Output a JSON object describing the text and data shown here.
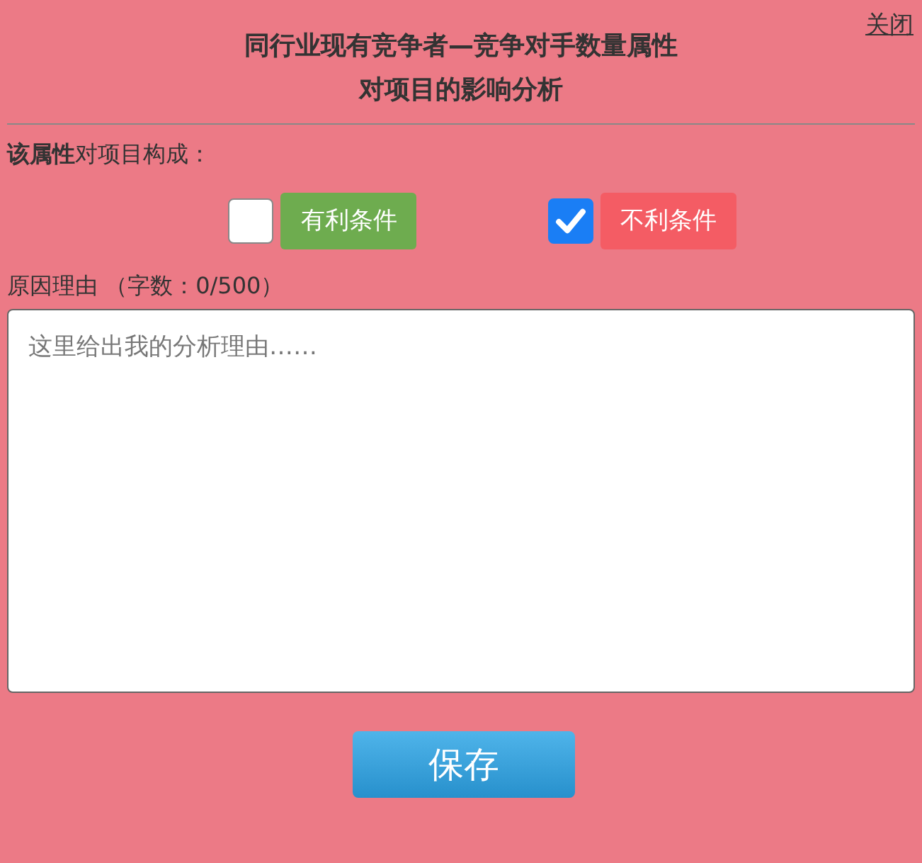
{
  "close_link": "关闭",
  "title_lines": [
    "同行业现有竞争者—竞争对手数量属性",
    "对项目的影响分析"
  ],
  "prompt": "**该属性**对项目构成：",
  "options": [
    {
      "label": "有利条件",
      "checked": false,
      "color": "#6eac4f"
    },
    {
      "label": "不利条件",
      "checked": true,
      "color": "#f45c64"
    }
  ],
  "reason_label": "原因理由 （字数：0/500）",
  "reason_field": {
    "placeholder": "这里给出我的分析理由……"
  },
  "save_button": "保存"
}
